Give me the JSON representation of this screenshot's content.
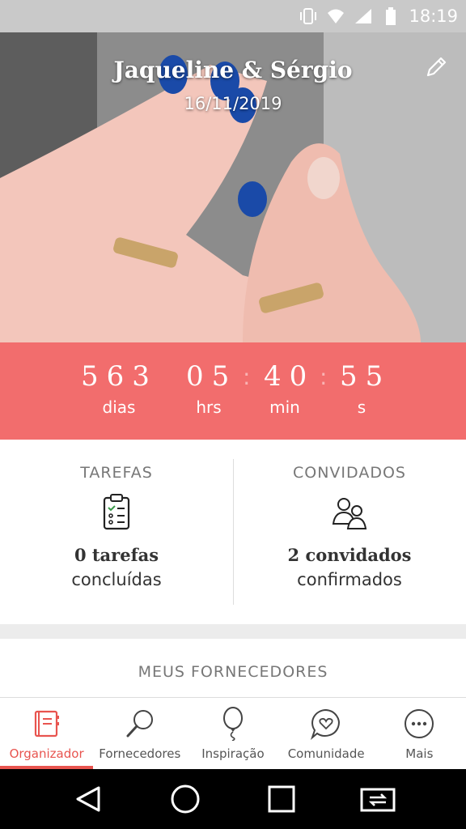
{
  "status_bar": {
    "time": "18:19",
    "icons": [
      "vibrate-icon",
      "wifi-icon",
      "signal-icon",
      "battery-icon"
    ]
  },
  "hero": {
    "couple_names": "Jaqueline & Sérgio",
    "wedding_date": "16/11/2019",
    "edit_icon": "pencil-icon"
  },
  "countdown": {
    "days": "563",
    "days_label": "dias",
    "hours": "05",
    "hours_label": "hrs",
    "minutes": "40",
    "minutes_label": "min",
    "seconds": "55",
    "seconds_label": "s",
    "separator": ":",
    "accent_color": "#f26d6d"
  },
  "stats": {
    "tasks": {
      "title": "TAREFAS",
      "count": "0 tarefas",
      "subtitle": "concluídas",
      "icon": "clipboard-checklist-icon"
    },
    "guests": {
      "title": "CONVIDADOS",
      "count": "2 convidados",
      "subtitle": "confirmados",
      "icon": "guests-icon"
    }
  },
  "providers": {
    "title": "MEUS FORNECEDORES"
  },
  "tab_bar": {
    "active_color": "#e8544f",
    "items": [
      {
        "label": "Organizador",
        "icon": "notebook-icon",
        "active": true
      },
      {
        "label": "Fornecedores",
        "icon": "search-icon",
        "active": false
      },
      {
        "label": "Inspiração",
        "icon": "balloon-icon",
        "active": false
      },
      {
        "label": "Comunidade",
        "icon": "chat-heart-icon",
        "active": false
      },
      {
        "label": "Mais",
        "icon": "more-icon",
        "active": false
      }
    ]
  },
  "nav_bar": {
    "buttons": [
      "back-icon",
      "home-icon",
      "recents-icon",
      "switch-app-icon"
    ]
  }
}
